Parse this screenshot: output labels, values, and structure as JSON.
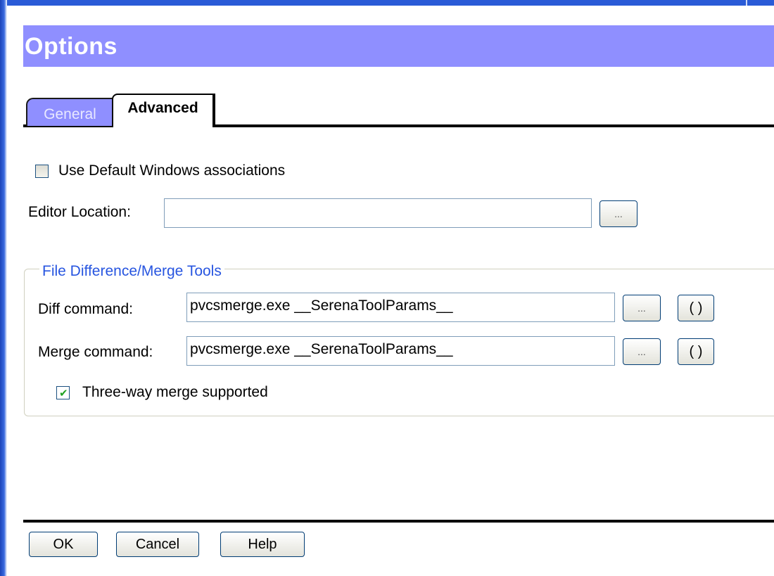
{
  "window": {
    "title": "Options"
  },
  "tabs": [
    {
      "label": "General",
      "active": false
    },
    {
      "label": "Advanced",
      "active": true
    }
  ],
  "advanced": {
    "use_default_assoc": {
      "label": "Use Default Windows associations",
      "checked": false
    },
    "editor_location": {
      "label": "Editor Location:",
      "value": "",
      "browse_label": "..."
    },
    "tools_group": {
      "legend": "File Difference/Merge Tools",
      "diff": {
        "label": "Diff command:",
        "value": "pvcsmerge.exe __SerenaToolParams__",
        "browse_label": "...",
        "params_label": "( )"
      },
      "merge": {
        "label": "Merge command:",
        "value": "pvcsmerge.exe __SerenaToolParams__",
        "browse_label": "...",
        "params_label": "( )"
      },
      "three_way": {
        "label": "Three-way merge supported",
        "checked": true
      }
    }
  },
  "footer": {
    "ok_label": "OK",
    "cancel_label": "Cancel",
    "help_label": "Help"
  },
  "colors": {
    "title_bg": "#8f8fff",
    "legend_text": "#2755e0",
    "check_green": "#21a121"
  }
}
